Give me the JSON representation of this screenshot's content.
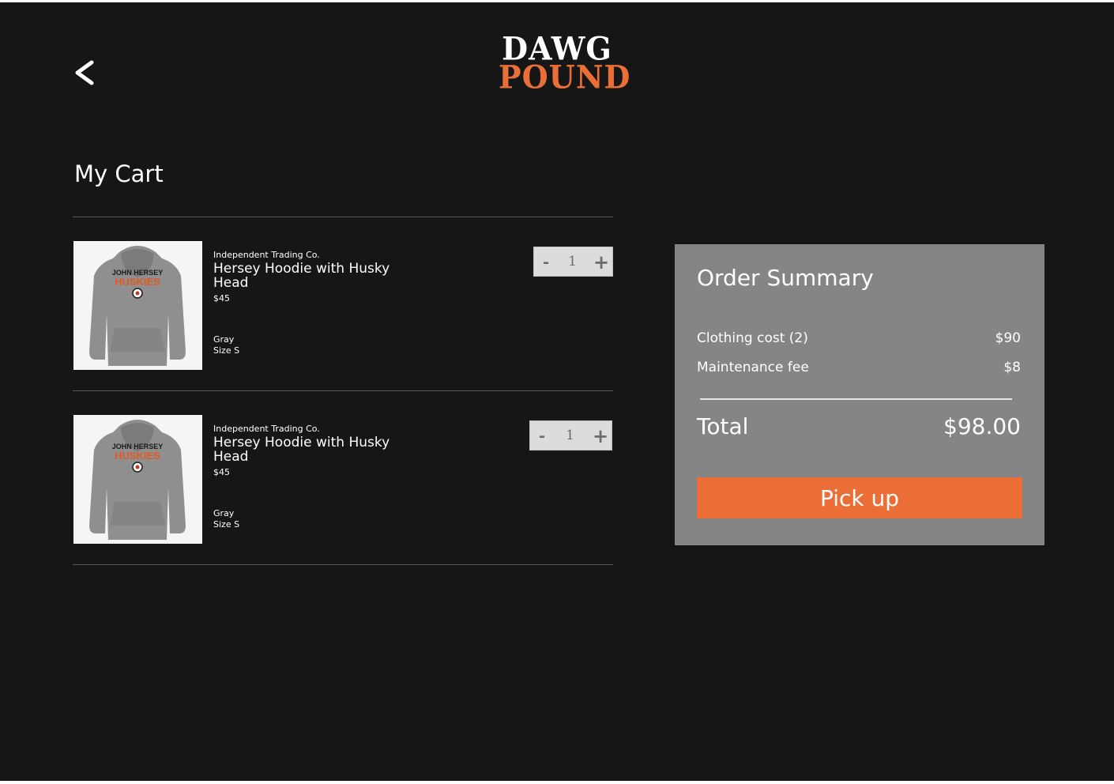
{
  "header": {
    "back_icon": "chevron-left-icon",
    "logo_line1": "DAWG",
    "logo_line2": "POUND"
  },
  "cart": {
    "title": "My Cart",
    "items": [
      {
        "brand": "Independent Trading Co.",
        "name": "Hersey Hoodie with Husky Head",
        "price": "$45",
        "color": "Gray",
        "size": "Size S",
        "quantity": "1",
        "minus_label": "-",
        "plus_label": "+",
        "print_line1": "JOHN HERSEY",
        "print_line2": "HUSKIES"
      },
      {
        "brand": "Independent Trading Co.",
        "name": "Hersey Hoodie with Husky Head",
        "price": "$45",
        "color": "Gray",
        "size": "Size S",
        "quantity": "1",
        "minus_label": "-",
        "plus_label": "+",
        "print_line1": "JOHN HERSEY",
        "print_line2": "HUSKIES"
      }
    ]
  },
  "summary": {
    "heading": "Order Summary",
    "clothing_label": "Clothing cost (2)",
    "clothing_value": "$90",
    "fee_label": "Maintenance fee",
    "fee_value": "$8",
    "total_label": "Total",
    "total_value": "$98.00",
    "button_label": "Pick up"
  },
  "colors": {
    "background": "#161616",
    "accent": "#ec6e37",
    "summary_panel": "#858585",
    "stepper": "#dcdcdc"
  }
}
